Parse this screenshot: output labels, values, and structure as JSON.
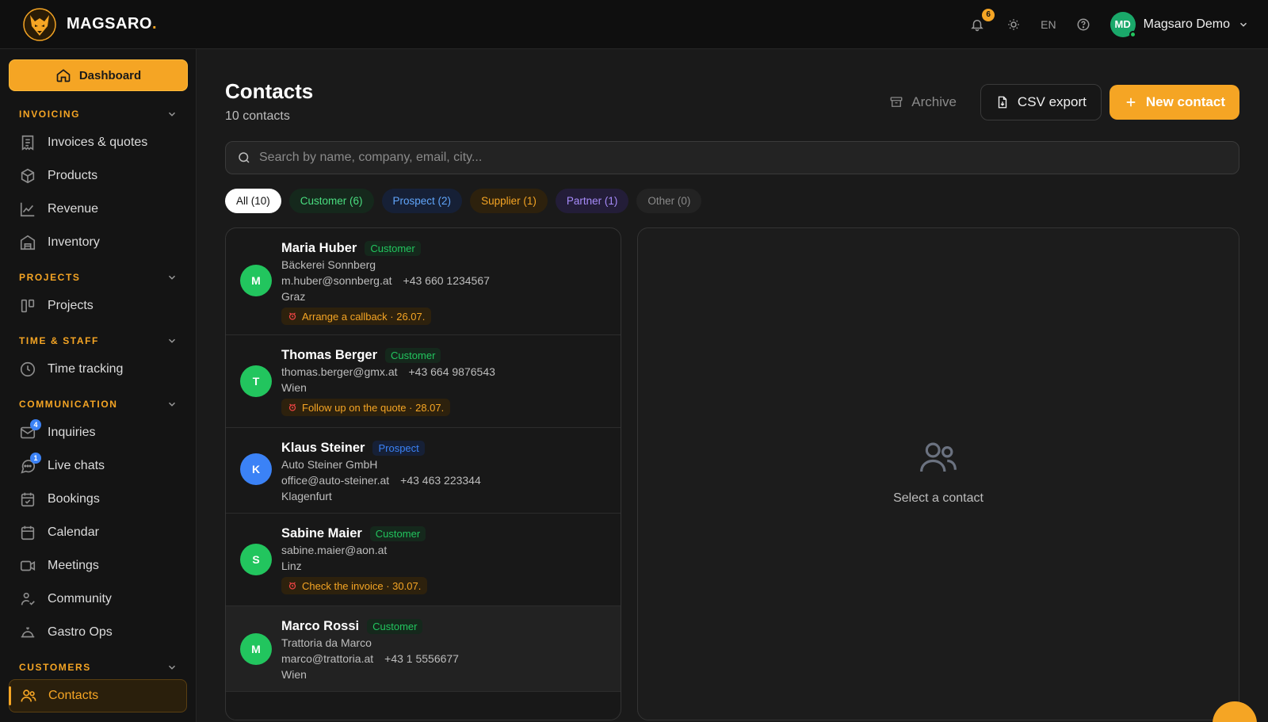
{
  "brand": {
    "name": "MAGSARO",
    "dot": "."
  },
  "topbar": {
    "notifications_count": "6",
    "language": "EN",
    "user": {
      "initials": "MD",
      "name": "Magsaro Demo"
    }
  },
  "sidebar": {
    "dashboard_label": "Dashboard",
    "sections": {
      "invoicing": "INVOICING",
      "projects": "PROJECTS",
      "time_staff": "TIME & STAFF",
      "communication": "COMMUNICATION",
      "customers": "CUSTOMERS"
    },
    "items": {
      "invoices": "Invoices & quotes",
      "products": "Products",
      "revenue": "Revenue",
      "inventory": "Inventory",
      "projects": "Projects",
      "time_tracking": "Time tracking",
      "inquiries": "Inquiries",
      "inquiries_badge": "4",
      "live_chats": "Live chats",
      "live_chats_badge": "1",
      "bookings": "Bookings",
      "calendar": "Calendar",
      "meetings": "Meetings",
      "community": "Community",
      "gastro_ops": "Gastro Ops",
      "contacts": "Contacts"
    }
  },
  "page": {
    "title": "Contacts",
    "subtitle": "10 contacts",
    "archive_label": "Archive",
    "csv_label": "CSV export",
    "new_label": "New contact",
    "search_placeholder": "Search by name, company, email, city..."
  },
  "filters": {
    "all": "All (10)",
    "customer": "Customer (6)",
    "prospect": "Prospect (2)",
    "supplier": "Supplier (1)",
    "partner": "Partner (1)",
    "other": "Other (0)"
  },
  "contacts": [
    {
      "initial": "M",
      "name": "Maria Huber",
      "tag": "Customer",
      "company": "Bäckerei Sonnberg",
      "email": "m.huber@sonnberg.at",
      "phone": "+43 660 1234567",
      "city": "Graz",
      "task": "Arrange a callback · 26.07."
    },
    {
      "initial": "T",
      "name": "Thomas Berger",
      "tag": "Customer",
      "email": "thomas.berger@gmx.at",
      "phone": "+43 664 9876543",
      "city": "Wien",
      "task": "Follow up on the quote · 28.07."
    },
    {
      "initial": "K",
      "name": "Klaus Steiner",
      "tag": "Prospect",
      "company": "Auto Steiner GmbH",
      "email": "office@auto-steiner.at",
      "phone": "+43 463 223344",
      "city": "Klagenfurt"
    },
    {
      "initial": "S",
      "name": "Sabine Maier",
      "tag": "Customer",
      "email": "sabine.maier@aon.at",
      "city": "Linz",
      "task": "Check the invoice · 30.07."
    },
    {
      "initial": "M",
      "name": "Marco Rossi",
      "tag": "Customer",
      "company": "Trattoria da Marco",
      "email": "marco@trattoria.at",
      "phone": "+43 1 5556677",
      "city": "Wien"
    }
  ],
  "detail": {
    "empty_text": "Select a contact"
  }
}
